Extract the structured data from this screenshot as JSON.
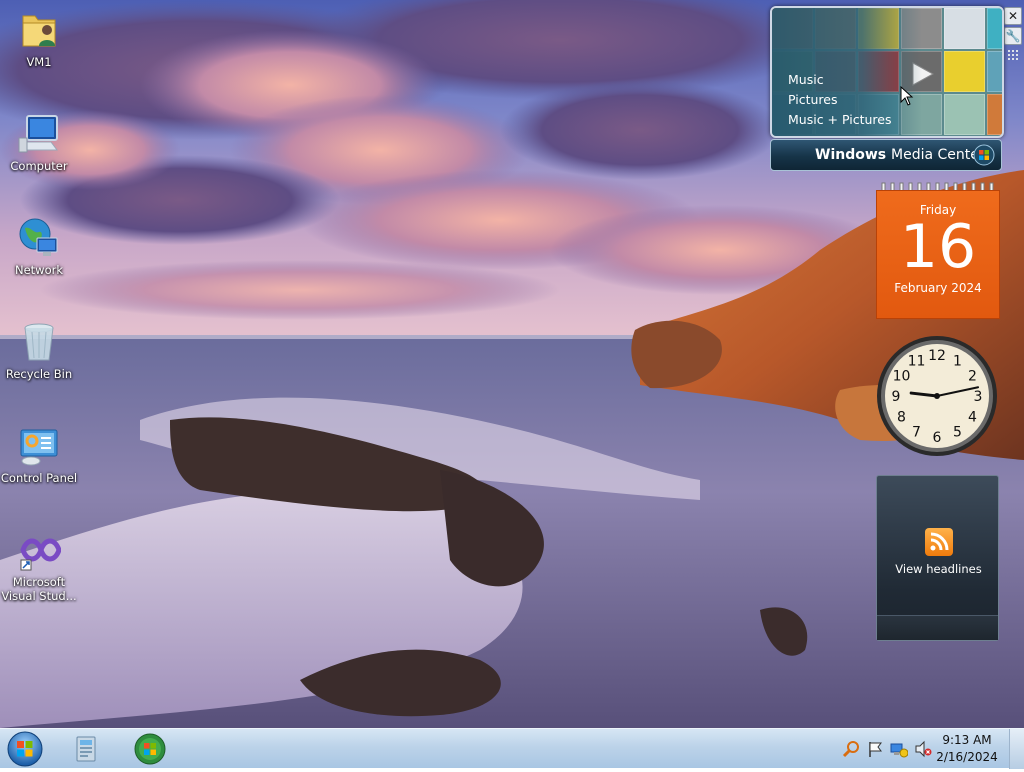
{
  "desktop": {
    "icons": [
      {
        "label": "VM1",
        "icon": "user-folder-icon"
      },
      {
        "label": "Computer",
        "icon": "computer-icon"
      },
      {
        "label": "Network",
        "icon": "network-icon"
      },
      {
        "label": "Recycle Bin",
        "icon": "recycle-bin-icon"
      },
      {
        "label": "Control Panel",
        "icon": "control-panel-icon"
      },
      {
        "label": "Microsoft Visual Stud...",
        "icon": "visual-studio-icon"
      }
    ]
  },
  "gadgets": {
    "media_center": {
      "menu": [
        "Music",
        "Pictures",
        "Music + Pictures"
      ],
      "brand_main": "Windows",
      "brand_sub": "Media Center"
    },
    "calendar": {
      "weekday": "Friday",
      "day": "16",
      "month_year": "February 2024"
    },
    "clock": {
      "hour": 9,
      "minute": 13,
      "numbers": [
        "12",
        "1",
        "2",
        "3",
        "4",
        "5",
        "6",
        "7",
        "8",
        "9",
        "10",
        "11"
      ]
    },
    "feed": {
      "text": "View headlines"
    },
    "controls": [
      "close-icon",
      "wrench-icon",
      "drag-grip-icon"
    ]
  },
  "taskbar": {
    "start": "windows-start-orb-icon",
    "apps": [
      "windows-explorer-icon",
      "windows-media-center-icon"
    ],
    "tray_icons": [
      "search-icon",
      "action-center-flag-icon",
      "network-icon",
      "volume-muted-icon"
    ],
    "time": "9:13 AM",
    "date": "2/16/2024"
  },
  "colors": {
    "calendar_orange": "#e85f12",
    "taskbar": "#bcd3e9",
    "media_center_bar": "#163448"
  }
}
